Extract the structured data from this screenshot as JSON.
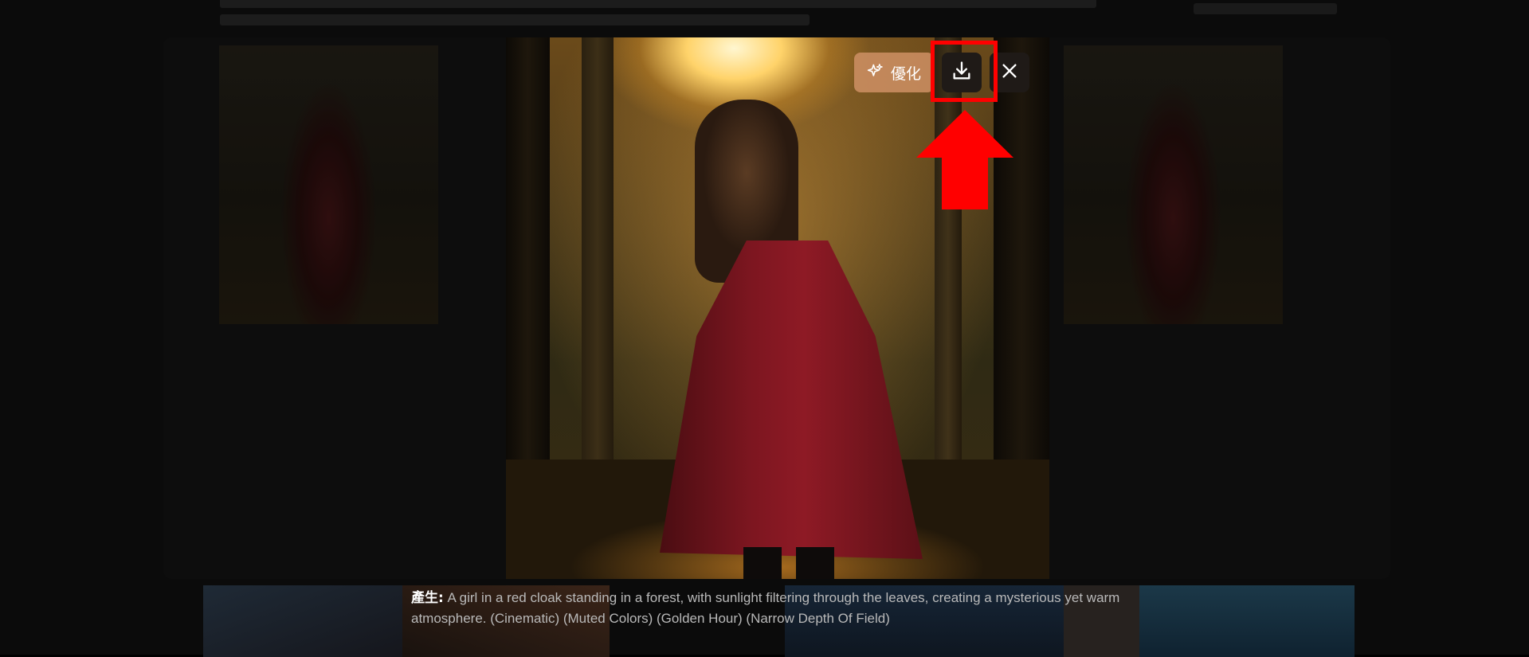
{
  "toolbar": {
    "enhance_label": "優化",
    "enhance_icon": "sparkle-icon",
    "download_icon": "download-icon",
    "close_icon": "close-icon"
  },
  "annotation": {
    "highlight_color": "#ff0000",
    "arrow_color": "#ff0000"
  },
  "caption": {
    "label": "產生:",
    "text": " A girl in a red cloak standing in a forest, with sunlight filtering through the leaves, creating a mysterious yet warm atmosphere. (Cinematic) (Muted Colors) (Golden Hour) (Narrow Depth Of Field)"
  }
}
